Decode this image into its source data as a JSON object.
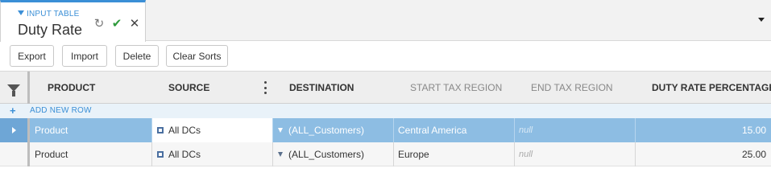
{
  "tab": {
    "subtitle": "INPUT TABLE",
    "title": "Duty Rate"
  },
  "toolbar": {
    "export_label": "Export",
    "import_label": "Import",
    "delete_label": "Delete",
    "clear_sorts_label": "Clear Sorts"
  },
  "grid": {
    "columns": {
      "product": "PRODUCT",
      "source": "SOURCE",
      "destination": "DESTINATION",
      "start_tax_region": "START TAX REGION",
      "end_tax_region": "END TAX REGION",
      "duty_rate_percentage": "DUTY RATE PERCENTAGE"
    },
    "add_row_label": "ADD NEW ROW",
    "rows": [
      {
        "product": "Product",
        "source": "All DCs",
        "destination": "(ALL_Customers)",
        "start_tax_region": "Central America",
        "end_tax_region": "null",
        "duty_rate_percentage": "15.00",
        "selected": true
      },
      {
        "product": "Product",
        "source": "All DCs",
        "destination": "(ALL_Customers)",
        "start_tax_region": "Europe",
        "end_tax_region": "null",
        "duty_rate_percentage": "25.00",
        "selected": false
      }
    ]
  },
  "icons": {
    "tab_subtitle": "dropdown-triangle-icon",
    "refresh": "refresh-icon",
    "save": "check-icon",
    "close": "close-icon",
    "overflow": "chevron-down-icon",
    "filter": "filter-icon",
    "column_menu": "kebab-menu-icon",
    "add": "plus-icon",
    "row_pointer": "row-arrow-icon",
    "source": "square-icon",
    "destination": "funnel-icon"
  },
  "colors": {
    "accent": "#3b8fd6",
    "selected_row": "#8dbde3",
    "check": "#2e9a3c"
  }
}
